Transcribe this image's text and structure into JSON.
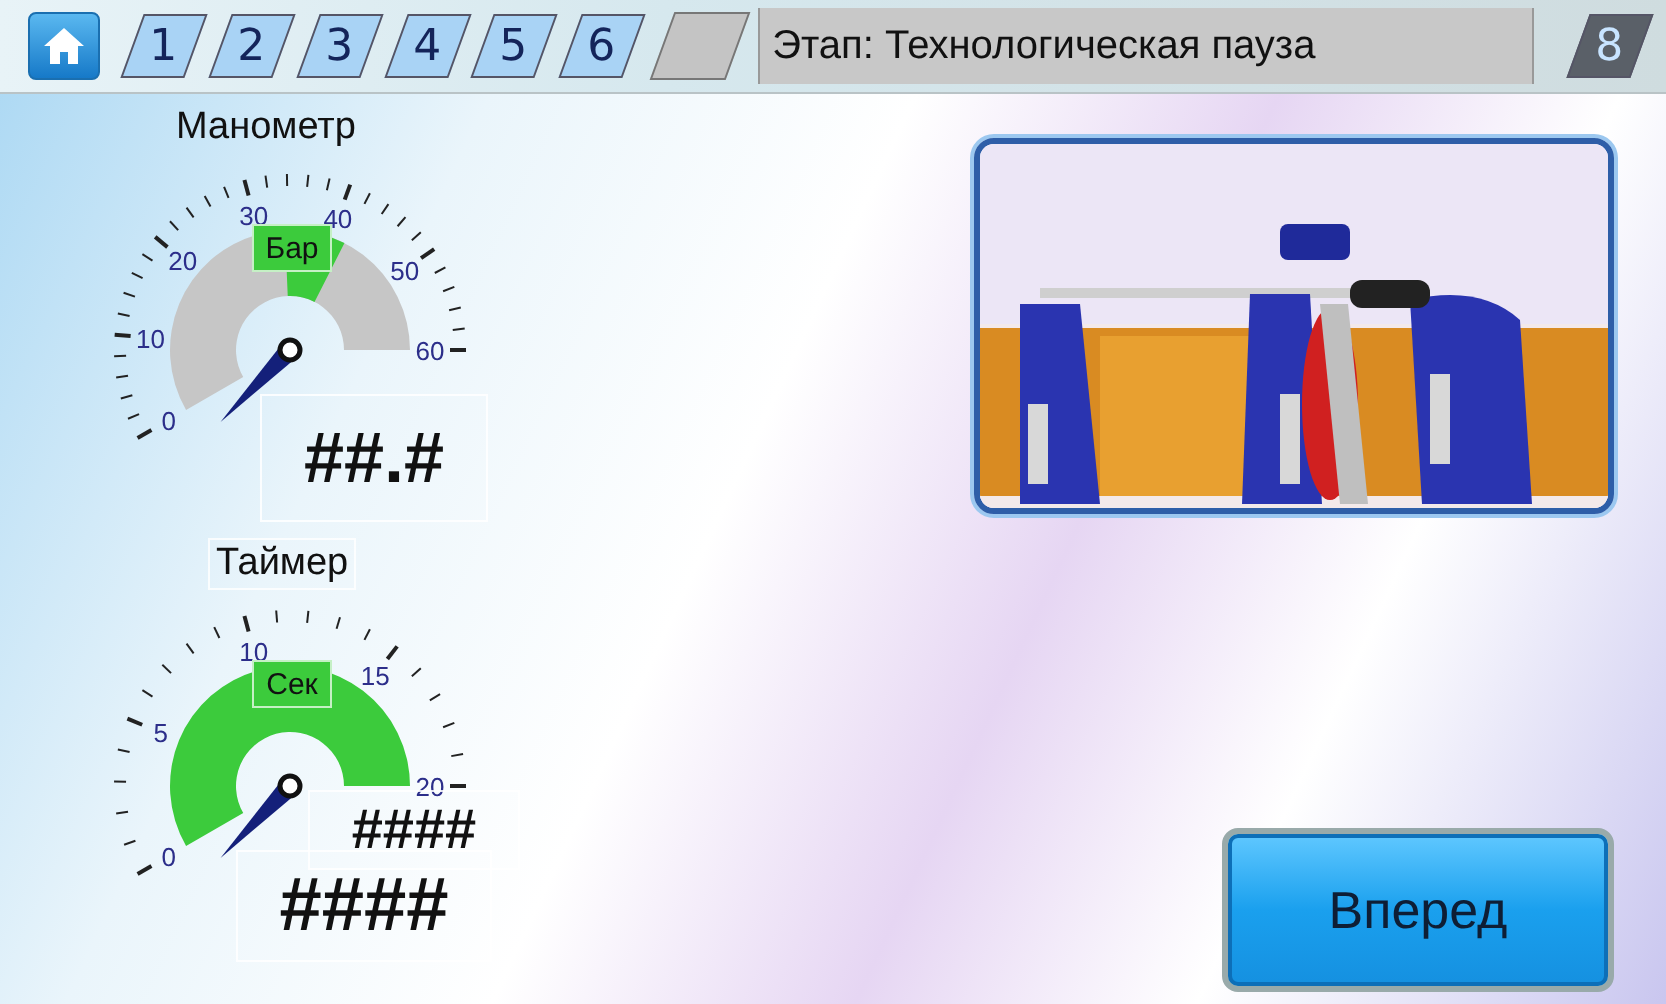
{
  "tabs": [
    {
      "label": "1",
      "selected": false
    },
    {
      "label": "2",
      "selected": false
    },
    {
      "label": "3",
      "selected": false
    },
    {
      "label": "4",
      "selected": false
    },
    {
      "label": "5",
      "selected": false
    },
    {
      "label": "6",
      "selected": false
    }
  ],
  "stage_title": "Этап: Технологическая пауза",
  "stage_tab": {
    "label": "8",
    "selected": true
  },
  "gauges": [
    {
      "kind": "pressure",
      "title": "Манометр",
      "unit": "Бар",
      "ticks": [
        "0",
        "10",
        "20",
        "30",
        "40",
        "50",
        "60"
      ],
      "readouts": [
        "##.#"
      ]
    },
    {
      "kind": "timer",
      "title": "Таймер",
      "unit": "Сек",
      "ticks": [
        "0",
        "5",
        "10",
        "15",
        "20"
      ],
      "readouts": [
        "####",
        "####"
      ]
    }
  ],
  "next_button": "Вперед"
}
